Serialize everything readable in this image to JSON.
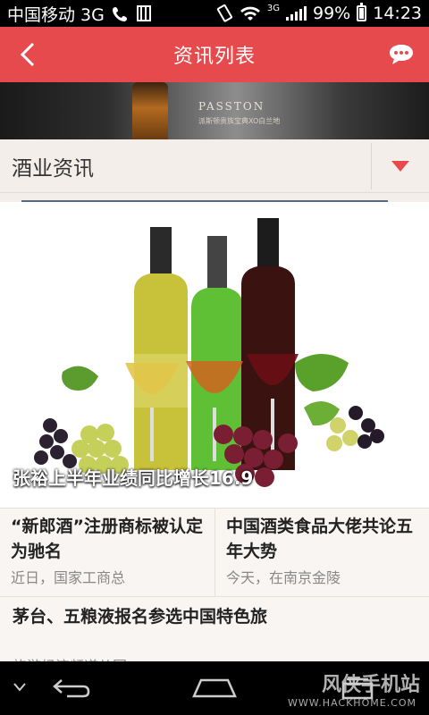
{
  "status_bar": {
    "carrier": "中国移动 3G",
    "network": "3G",
    "battery": "99%",
    "time": "14:23"
  },
  "header": {
    "title": "资讯列表"
  },
  "banner": {
    "brand": "PASSTON",
    "subtitle": "派斯顿贵族宝典XO白兰地"
  },
  "category": {
    "label": "酒业资讯"
  },
  "hero": {
    "caption": "张裕上半年业绩同比增长16.9"
  },
  "news": [
    {
      "title": "“新郎酒”注册商标被认定为驰名",
      "meta": "近日，国家工商总"
    },
    {
      "title": "中国酒类食品大佬共论五年大势",
      "meta": "今天，在南京金陵"
    }
  ],
  "news_full": {
    "title": "茅台、五粮液报名参选中国特色旅",
    "meta": "旅游经济频道从国"
  },
  "watermark": {
    "text": "风侠手机站",
    "url": "WWW.HACKHOME.COM"
  },
  "colors": {
    "header_bg": "#e74a4c",
    "dropdown_arrow": "#e74a4c",
    "background": "#f3eeea"
  }
}
